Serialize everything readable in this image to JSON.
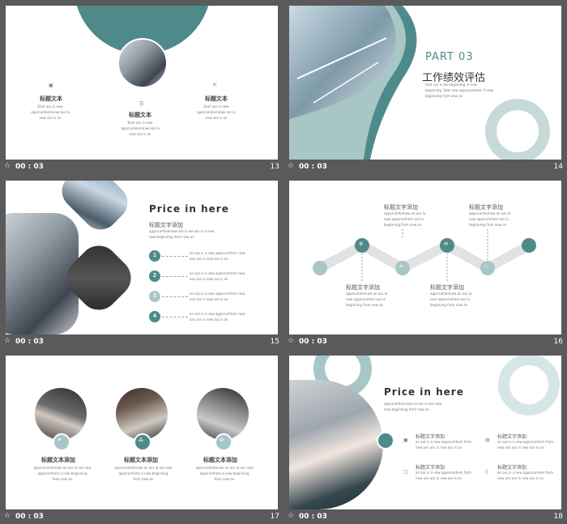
{
  "colors": {
    "teal": "#4f8a8b",
    "light_teal": "#a9c6c7",
    "pale": "#d6e6e6",
    "bg": "#5a5a5a"
  },
  "slides": [
    {
      "number": "13",
      "time": "00 : 03",
      "items": [
        {
          "icon": "copy-icon",
          "title": "标题文本",
          "text": [
            "Eeet ass is new",
            "appsrumhemnaw ass la",
            "new ass is an"
          ]
        },
        {
          "icon": "list-icon",
          "title": "标题文本",
          "text": [
            "Eeet ass is new",
            "appsrumhemnaw ass la",
            "new ass is an"
          ]
        },
        {
          "icon": "export-icon",
          "title": "标题文本",
          "text": [
            "Eeet ass is new",
            "appsrumhemnaw ass la",
            "new ass is an"
          ]
        }
      ]
    },
    {
      "number": "14",
      "time": "00 : 03",
      "part": "PART 03",
      "heading": "工作绩效评估",
      "text": [
        "Asst cas is ew beginning. A new",
        "beginning. Sets new appseumhem. A new",
        "beginning from new an"
      ]
    },
    {
      "number": "15",
      "time": "00 : 03",
      "title": "Price in here",
      "subtitle": "标题文字添加",
      "lead": [
        "appsrumhemnaw ass la ew ass is a new",
        "new beginning from new an"
      ],
      "steps": [
        {
          "n": "1",
          "text": [
            "an ass is a new appsrumfrom new",
            "ans ass is new ass is an"
          ]
        },
        {
          "n": "2",
          "text": [
            "an ass is a new appsrumfrom new",
            "ans ass is new ass is an"
          ]
        },
        {
          "n": "3",
          "text": [
            "an ass is a new appsrumfrom new",
            "ans ass is new ass is an"
          ]
        },
        {
          "n": "4",
          "text": [
            "an ass is a new appsrumfrom new",
            "ans ass is new ass is an"
          ]
        }
      ]
    },
    {
      "number": "16",
      "time": "00 : 03",
      "top_labels": [
        {
          "title": "标题文字添加",
          "text": [
            "appsrumhemaw an ass la",
            "new appsrumhem ass la",
            "beginning from new an"
          ]
        },
        {
          "title": "标题文字添加",
          "text": [
            "appsrumhemaw an ass la",
            "new appsrumhem ass la",
            "beginning from new an"
          ]
        }
      ],
      "bottom_labels": [
        {
          "title": "标题文字添加",
          "text": [
            "appsrumhemaw an ass la",
            "new appsrumhem ass la",
            "beginning from new an"
          ]
        },
        {
          "title": "标题文字添加",
          "text": [
            "appsrumhemaw an ass la",
            "new appsrumhem ass la",
            "beginning from new an"
          ]
        }
      ]
    },
    {
      "number": "17",
      "time": "00 : 03",
      "cards": [
        {
          "title": "标题文本添加",
          "text": [
            "appsrumhemnaw an ass la ass new",
            "appsrumhem a new beginning",
            "from new an"
          ]
        },
        {
          "title": "标题文本添加",
          "text": [
            "appsrumhemnaw an ass la ass new",
            "appsrumhem a new beginning",
            "from new an"
          ]
        },
        {
          "title": "标题文本添加",
          "text": [
            "appsrumhemnaw an ass la ass new",
            "appsrumhem a new beginning",
            "from new an"
          ]
        }
      ]
    },
    {
      "number": "18",
      "time": "00 : 03",
      "title": "Price in here",
      "lead": [
        "appsrumhemnaw an ass la ass new",
        "new beginning from new an"
      ],
      "items": [
        {
          "title": "标题文字添加",
          "text": [
            "an ass is a new appsrumhem from",
            "new ans ass is new ass is an"
          ]
        },
        {
          "title": "标题文字添加",
          "text": [
            "an ass is a new appsrumhem from",
            "new ans ass is new ass is an"
          ]
        },
        {
          "title": "标题文字添加",
          "text": [
            "an ass is a new appsrumhem from",
            "new ans ass is new ass is an"
          ]
        },
        {
          "title": "标题文字添加",
          "text": [
            "an ass is a new appsrumhem from",
            "new ans ass is new ass is an"
          ]
        }
      ]
    }
  ]
}
